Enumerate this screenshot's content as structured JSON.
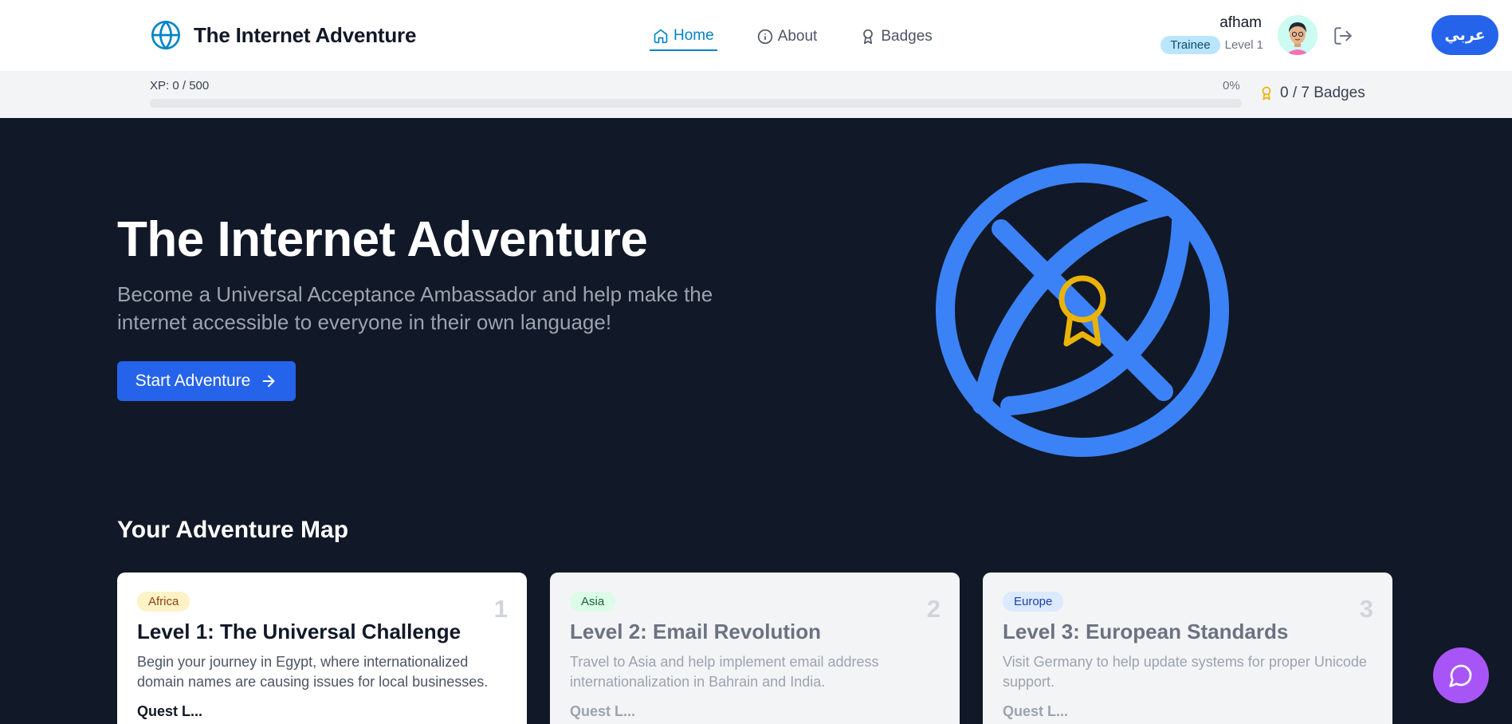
{
  "header": {
    "app_title": "The Internet Adventure",
    "brand_icon": "globe-icon",
    "nav": [
      {
        "label": "Home",
        "icon": "home-icon",
        "active": true
      },
      {
        "label": "About",
        "icon": "info-icon",
        "active": false
      },
      {
        "label": "Badges",
        "icon": "award-icon",
        "active": false
      }
    ],
    "user": {
      "name": "afham",
      "rank": "Trainee",
      "level": "Level 1"
    },
    "language_button": "عربي"
  },
  "progress": {
    "xp_label": "XP: 0 / 500",
    "percent_label": "0%",
    "fraction": 0,
    "badges_label": "0 / 7 Badges"
  },
  "hero": {
    "title": "The Internet Adventure",
    "subtitle": "Become a Universal Acceptance Ambassador and help make the internet accessible to everyone in their own language!",
    "cta": "Start Adventure"
  },
  "map": {
    "title": "Your Adventure Map",
    "levels": [
      {
        "region": "Africa",
        "number": "1",
        "title": "Level 1: The Universal Challenge",
        "description": "Begin your journey in Egypt, where internationalized domain names are causing issues for local businesses.",
        "footer": "Quest L..."
      },
      {
        "region": "Asia",
        "number": "2",
        "title": "Level 2: Email Revolution",
        "description": "Travel to Asia and help implement email address internationalization in Bahrain and India.",
        "footer": "Quest L..."
      },
      {
        "region": "Europe",
        "number": "3",
        "title": "Level 3: European Standards",
        "description": "Visit Germany to help update systems for proper Unicode support.",
        "footer": "Quest L..."
      }
    ]
  },
  "colors": {
    "primary": "#2563eb",
    "hero_bg": "#111827",
    "africa_badge_bg": "#fef3c7",
    "africa_badge_fg": "#92400e",
    "asia_badge_bg": "#dcfce7",
    "asia_badge_fg": "#166534",
    "europe_badge_bg": "#dbeafe",
    "europe_badge_fg": "#1e40af",
    "chat": "#a855f7",
    "award": "#eab308"
  }
}
